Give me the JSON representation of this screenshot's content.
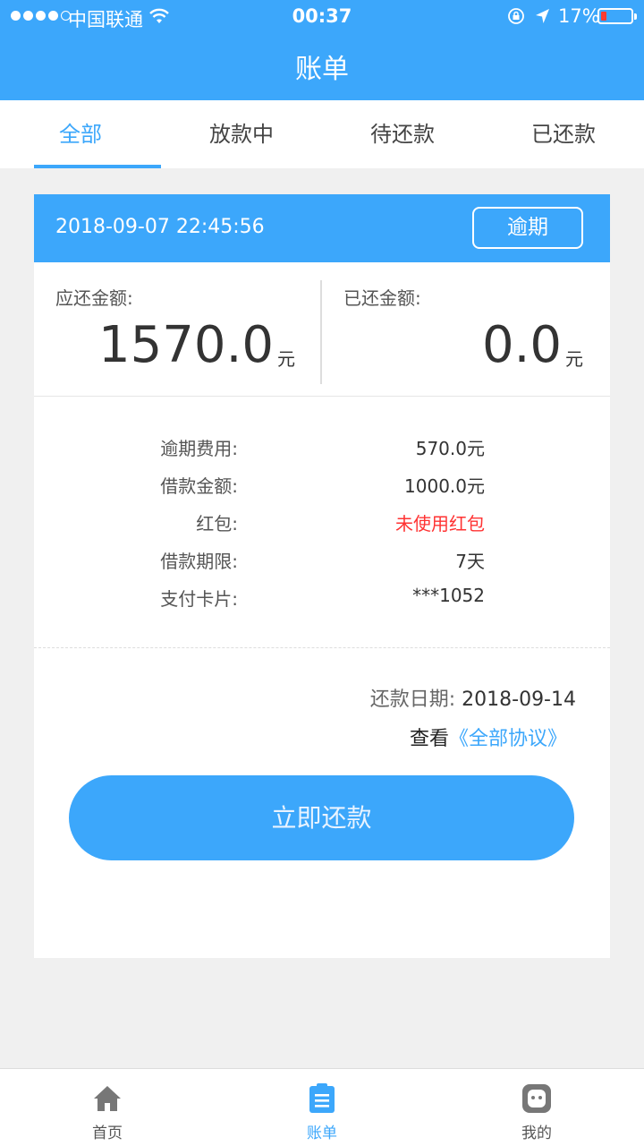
{
  "status_bar": {
    "carrier": "中国联通",
    "time": "00:37",
    "battery": "17%",
    "battery_level": 0.17,
    "icons": [
      "signal-dots-icon",
      "wifi-icon",
      "rotation-lock-icon",
      "location-arrow-icon",
      "battery-icon"
    ]
  },
  "header": {
    "title": "账单"
  },
  "tabs": [
    {
      "label": "全部",
      "active": true
    },
    {
      "label": "放款中",
      "active": false
    },
    {
      "label": "待还款",
      "active": false
    },
    {
      "label": "已还款",
      "active": false
    }
  ],
  "bill": {
    "datetime": "2018-09-07 22:45:56",
    "status": "逾期",
    "due_amount_label": "应还金额:",
    "due_amount": "1570.0",
    "due_amount_unit": "元",
    "paid_amount_label": "已还金额:",
    "paid_amount": "0.0",
    "paid_amount_unit": "元",
    "details": [
      {
        "label": "逾期费用:",
        "value": "570.0元"
      },
      {
        "label": "借款金额:",
        "value": "1000.0元"
      },
      {
        "label": "红包:",
        "value": "未使用红包"
      },
      {
        "label": "借款期限:",
        "value": "7天"
      },
      {
        "label": "支付卡片:",
        "value": "***1052"
      }
    ],
    "repay_date_label": "还款日期:",
    "repay_date": "2018-09-14",
    "view_label": "查看",
    "protocol_link": "《全部协议》",
    "pay_button": "立即还款"
  },
  "colors": {
    "primary": "#3ca7fb",
    "warning": "#ff3333"
  },
  "tabbar": [
    {
      "label": "首页",
      "icon": "home-icon",
      "active": false
    },
    {
      "label": "账单",
      "icon": "bill-icon",
      "active": true
    },
    {
      "label": "我的",
      "icon": "profile-icon",
      "active": false
    }
  ]
}
